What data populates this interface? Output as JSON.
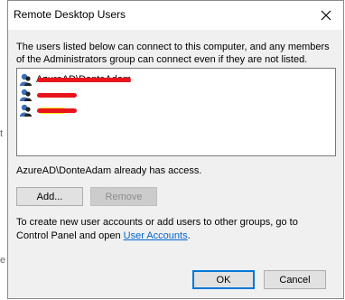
{
  "background": {
    "glyph_top": "t",
    "glyph_bottom": "e"
  },
  "dialog": {
    "title": "Remote Desktop Users",
    "intro": "The users listed below can connect to this computer, and any members of the Administrators group can connect even if they are not listed.",
    "users": [
      {
        "name": "AzureAD\\DonteAdam"
      },
      {
        "name": ""
      },
      {
        "name": ""
      }
    ],
    "access_message": "AzureAD\\DonteAdam already has access.",
    "add_label": "Add...",
    "remove_label": "Remove",
    "help_prefix": "To create new user accounts or add users to other groups, go to Control Panel and open ",
    "help_link": "User Accounts",
    "help_suffix": ".",
    "ok_label": "OK",
    "cancel_label": "Cancel"
  },
  "colors": {
    "accent": "#0078d7",
    "link": "#0066cc",
    "redaction": "#e8141b",
    "highlight": "#f2ef1a"
  },
  "icons": {
    "close": "close-icon",
    "user": "user-icon"
  }
}
